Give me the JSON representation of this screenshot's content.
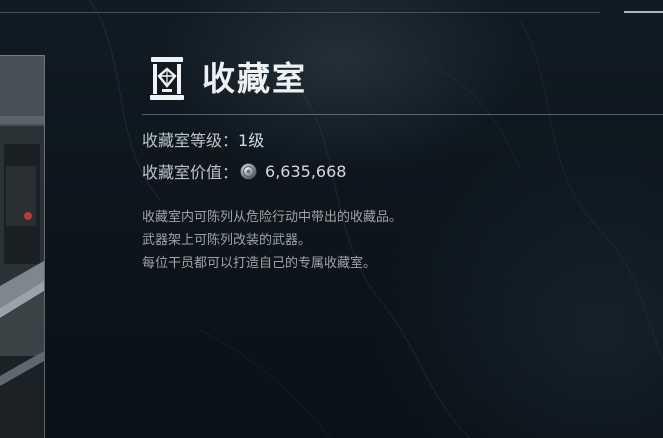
{
  "header": {
    "title": "收藏室",
    "icon": "collection-room-icon"
  },
  "stats": {
    "level_label": "收藏室等级：",
    "level_value": "1级",
    "value_label": "收藏室价值：",
    "value_icon": "silver-coin-icon",
    "value_amount": "6,635,668"
  },
  "description": {
    "line1": "收藏室内可陈列从危险行动中带出的收藏品。",
    "line2": "武器架上可陈列改装的武器。",
    "line3": "每位干员都可以打造自己的专属收藏室。"
  },
  "colors": {
    "background": "#0c131a",
    "title": "#eef2f4",
    "text": "#bcc4ca",
    "description": "#9aa4ab"
  }
}
